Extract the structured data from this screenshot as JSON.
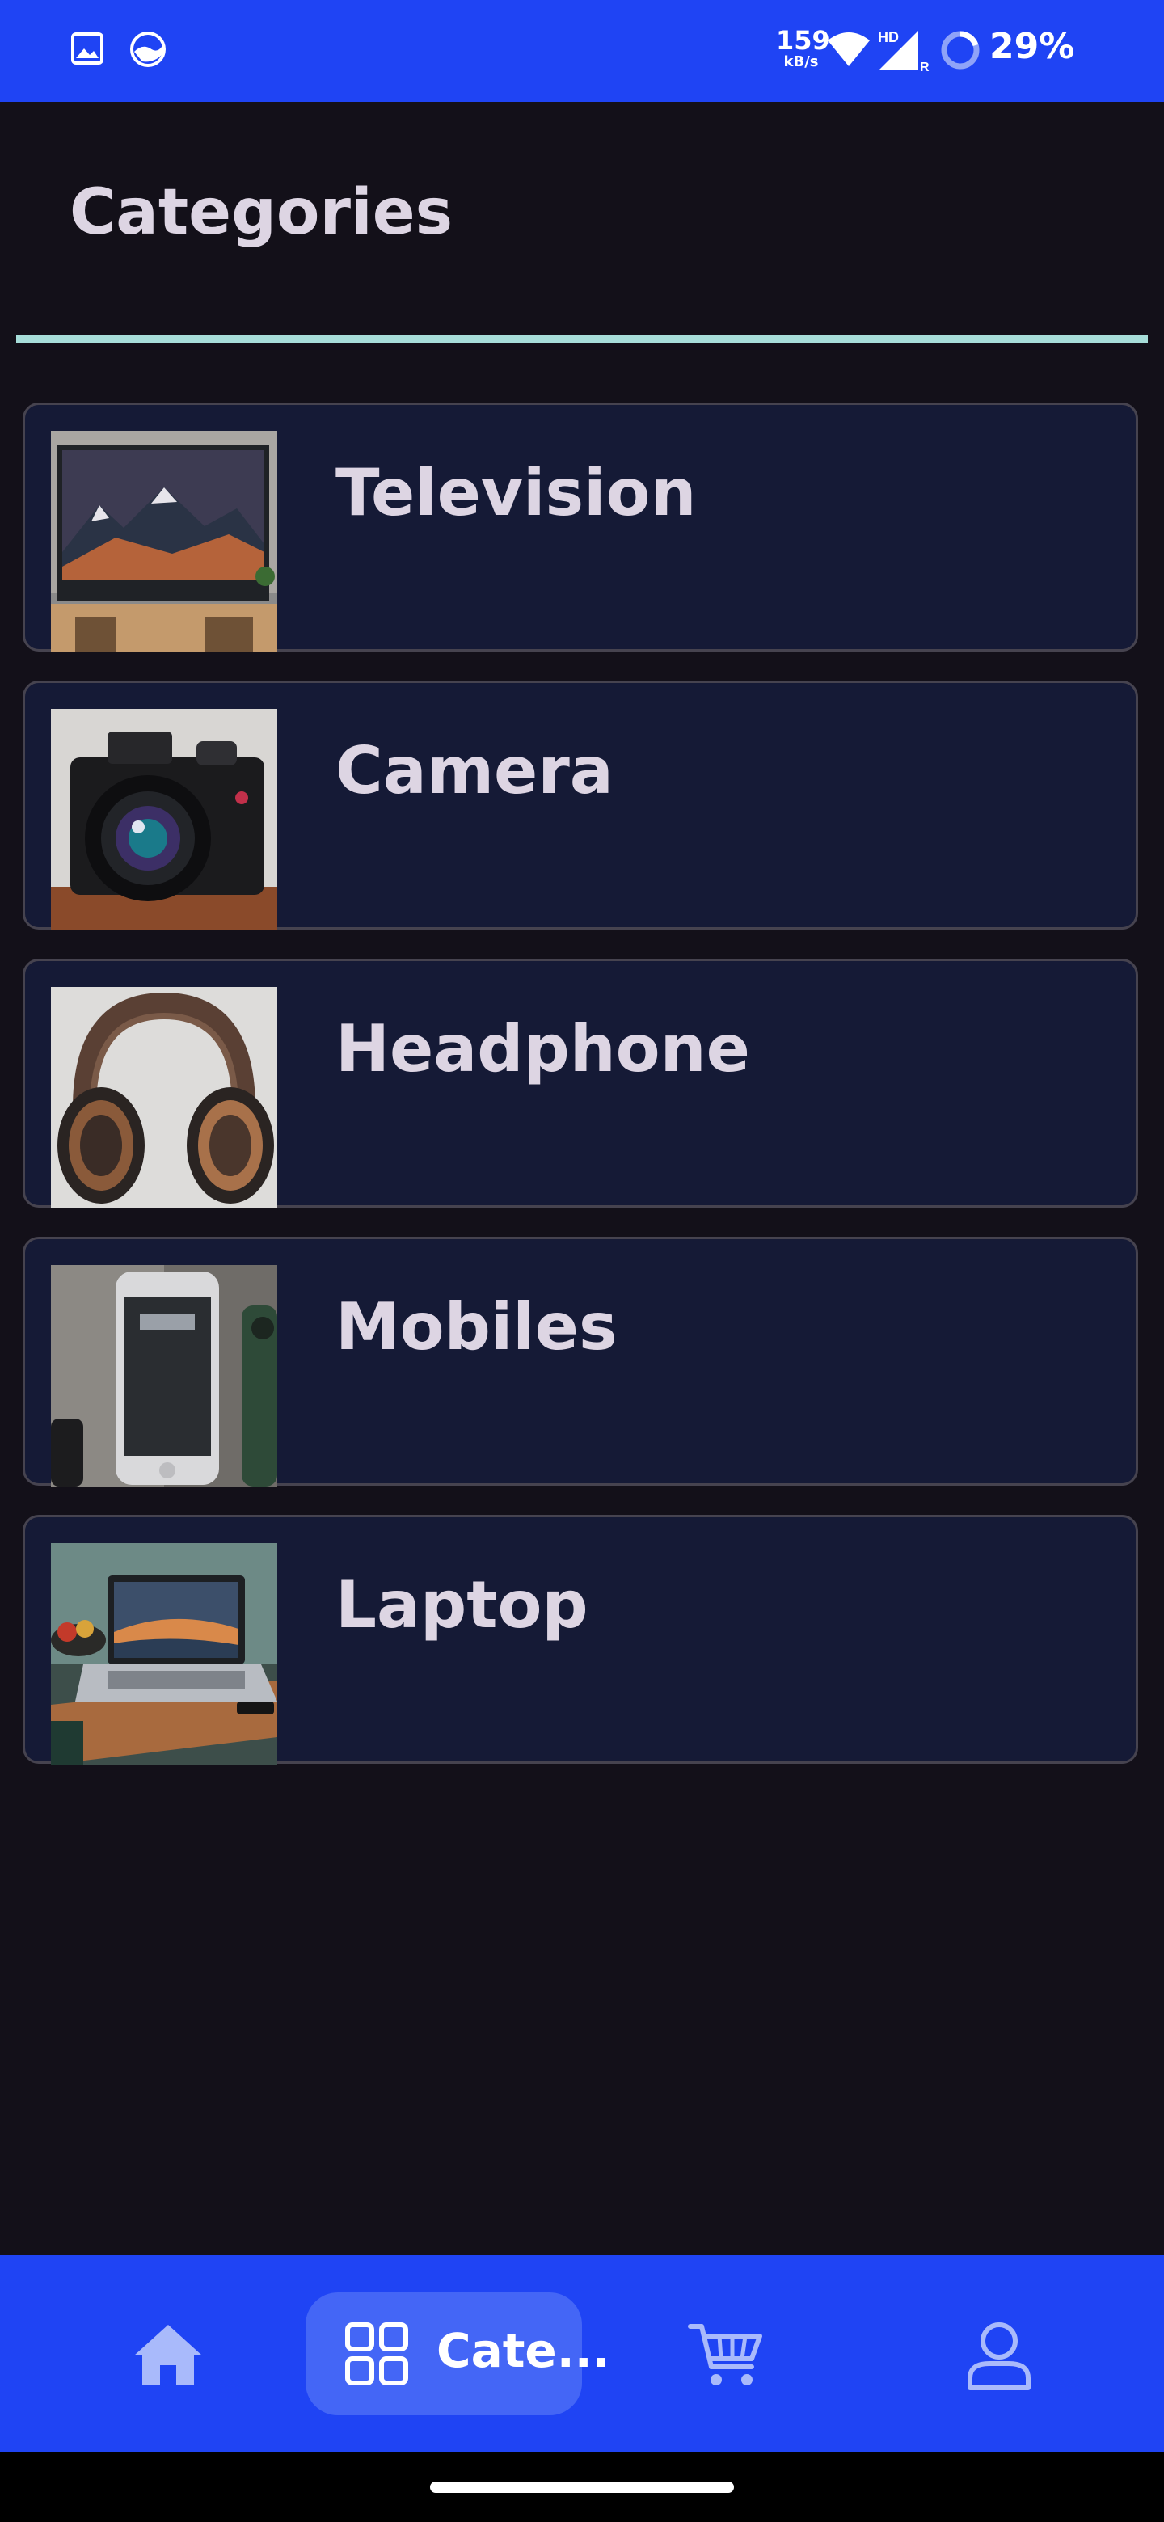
{
  "status_bar": {
    "net_speed": "159",
    "net_unit": "kB/s",
    "network_badge": "HD",
    "signal_sub": "R",
    "battery": "29%",
    "icons": [
      "gallery-icon",
      "app-notification-icon",
      "wifi-icon",
      "signal-icon",
      "battery-ring-icon"
    ]
  },
  "header": {
    "title": "Categories"
  },
  "categories": [
    {
      "label": "Television",
      "image": "television-image"
    },
    {
      "label": "Camera",
      "image": "camera-image"
    },
    {
      "label": "Headphone",
      "image": "headphone-image"
    },
    {
      "label": "Mobiles",
      "image": "mobile-image"
    },
    {
      "label": "Laptop",
      "image": "laptop-image"
    }
  ],
  "bottom_nav": {
    "items": [
      {
        "icon": "home-icon",
        "label": ""
      },
      {
        "icon": "grid-icon",
        "label": "Cate..."
      },
      {
        "icon": "cart-icon",
        "label": ""
      },
      {
        "icon": "profile-icon",
        "label": ""
      }
    ],
    "active_index": 1
  },
  "colors": {
    "accent": "#1f44f4",
    "active_pill": "#4466f6",
    "background": "#131019",
    "card": "#151a36",
    "divider": "#a7ddd9",
    "text": "#ddd5e3"
  }
}
